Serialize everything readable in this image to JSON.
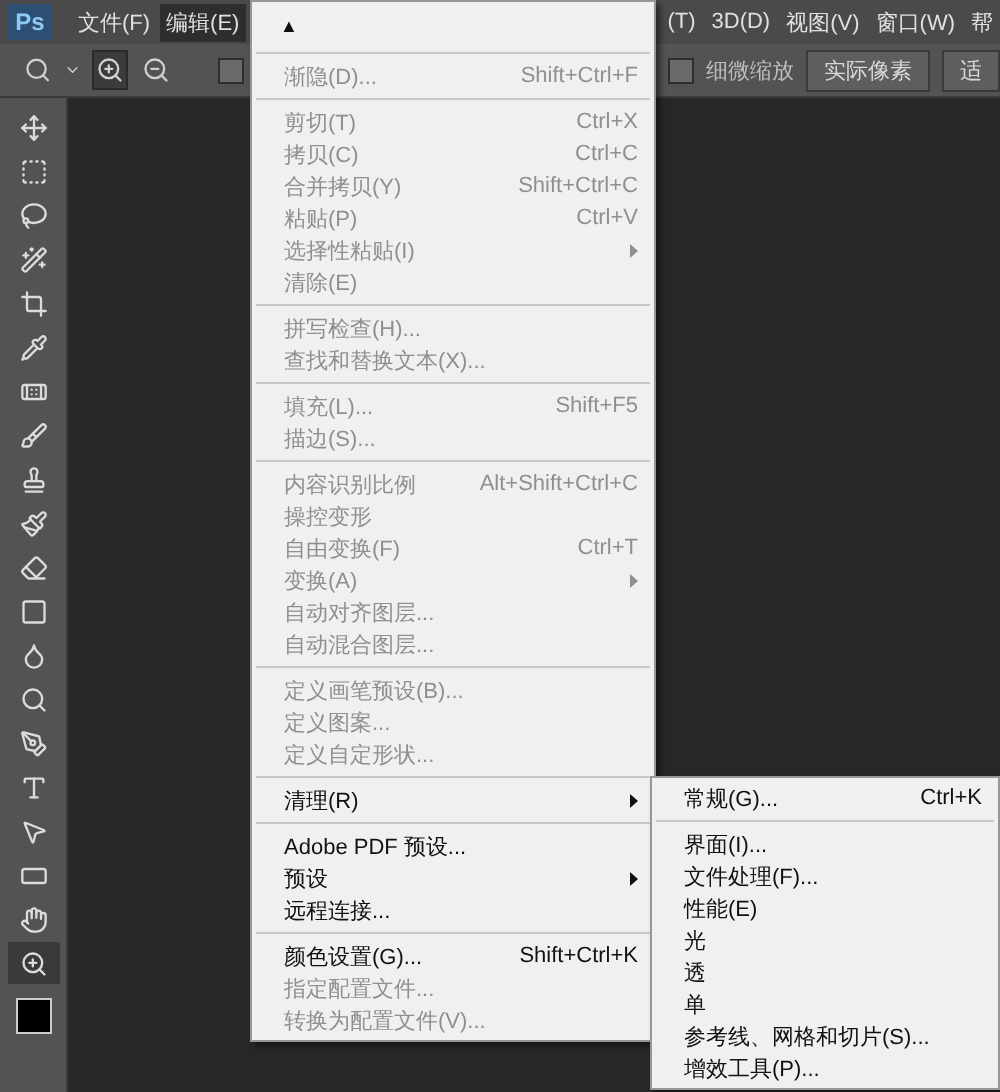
{
  "menubar": {
    "logo": "Ps",
    "items": [
      {
        "label": "文件(F)",
        "selected": false
      },
      {
        "label": "编辑(E)",
        "selected": true
      }
    ],
    "items_right": [
      {
        "label": "(T)"
      },
      {
        "label": "3D(D)"
      },
      {
        "label": "视图(V)"
      },
      {
        "label": "窗口(W)"
      },
      {
        "label": "帮"
      }
    ]
  },
  "options": {
    "zoom_modes": [
      {
        "kind": "in",
        "selected": true
      },
      {
        "kind": "out",
        "selected": false
      }
    ],
    "hidden_checkbox": {
      "checked": false
    },
    "fine_zoom": {
      "label": "细微缩放",
      "checked": false
    },
    "buttons": [
      "实际像素",
      "适"
    ]
  },
  "tools": [
    {
      "kind": "move",
      "selected": false
    },
    {
      "kind": "marquee",
      "selected": false
    },
    {
      "kind": "lasso",
      "selected": false
    },
    {
      "kind": "wand",
      "selected": false
    },
    {
      "kind": "crop",
      "selected": false
    },
    {
      "kind": "eyedropper",
      "selected": false
    },
    {
      "kind": "bandage",
      "selected": false
    },
    {
      "kind": "brush",
      "selected": false
    },
    {
      "kind": "stamp",
      "selected": false
    },
    {
      "kind": "history",
      "selected": false
    },
    {
      "kind": "eraser",
      "selected": false
    },
    {
      "kind": "gradient",
      "selected": false
    },
    {
      "kind": "drop",
      "selected": false
    },
    {
      "kind": "dodge",
      "selected": false
    },
    {
      "kind": "pen",
      "selected": false
    },
    {
      "kind": "type",
      "selected": false
    },
    {
      "kind": "pointer",
      "selected": false
    },
    {
      "kind": "rectangle",
      "selected": false
    },
    {
      "kind": "hand",
      "selected": false
    },
    {
      "kind": "zoom",
      "selected": true
    }
  ],
  "edit_menu": {
    "scroll_up": "▲",
    "groups": [
      [
        {
          "label": "渐隐(D)...",
          "shortcut": "Shift+Ctrl+F",
          "disabled": true,
          "submenu": false
        }
      ],
      [
        {
          "label": "剪切(T)",
          "shortcut": "Ctrl+X",
          "disabled": true,
          "submenu": false
        },
        {
          "label": "拷贝(C)",
          "shortcut": "Ctrl+C",
          "disabled": true,
          "submenu": false
        },
        {
          "label": "合并拷贝(Y)",
          "shortcut": "Shift+Ctrl+C",
          "disabled": true,
          "submenu": false
        },
        {
          "label": "粘贴(P)",
          "shortcut": "Ctrl+V",
          "disabled": true,
          "submenu": false
        },
        {
          "label": "选择性粘贴(I)",
          "disabled": true,
          "submenu": true
        },
        {
          "label": "清除(E)",
          "disabled": true,
          "submenu": false
        }
      ],
      [
        {
          "label": "拼写检查(H)...",
          "disabled": true,
          "submenu": false
        },
        {
          "label": "查找和替换文本(X)...",
          "disabled": true,
          "submenu": false
        }
      ],
      [
        {
          "label": "填充(L)...",
          "shortcut": "Shift+F5",
          "disabled": true,
          "submenu": false
        },
        {
          "label": "描边(S)...",
          "disabled": true,
          "submenu": false
        }
      ],
      [
        {
          "label": "内容识别比例",
          "shortcut": "Alt+Shift+Ctrl+C",
          "disabled": true,
          "submenu": false
        },
        {
          "label": "操控变形",
          "disabled": true,
          "submenu": false
        },
        {
          "label": "自由变换(F)",
          "shortcut": "Ctrl+T",
          "disabled": true,
          "submenu": false
        },
        {
          "label": "变换(A)",
          "disabled": true,
          "submenu": true
        },
        {
          "label": "自动对齐图层...",
          "disabled": true,
          "submenu": false
        },
        {
          "label": "自动混合图层...",
          "disabled": true,
          "submenu": false
        }
      ],
      [
        {
          "label": "定义画笔预设(B)...",
          "disabled": true,
          "submenu": false
        },
        {
          "label": "定义图案...",
          "disabled": true,
          "submenu": false
        },
        {
          "label": "定义自定形状...",
          "disabled": true,
          "submenu": false
        }
      ],
      [
        {
          "label": "清理(R)",
          "disabled": false,
          "submenu": true
        }
      ],
      [
        {
          "label": "Adobe PDF 预设...",
          "disabled": false,
          "submenu": false
        },
        {
          "label": "预设",
          "disabled": false,
          "submenu": true
        },
        {
          "label": "远程连接...",
          "disabled": false,
          "submenu": false
        }
      ],
      [
        {
          "label": "颜色设置(G)...",
          "shortcut": "Shift+Ctrl+K",
          "disabled": false,
          "submenu": false
        },
        {
          "label": "指定配置文件...",
          "disabled": true,
          "submenu": false
        },
        {
          "label": "转换为配置文件(V)...",
          "disabled": true,
          "submenu": false
        }
      ]
    ]
  },
  "preferences_menu": {
    "groups": [
      [
        {
          "label": "常规(G)...",
          "shortcut": "Ctrl+K"
        }
      ],
      [
        {
          "label": "界面(I)..."
        },
        {
          "label": "文件处理(F)..."
        },
        {
          "label": "性能(E)"
        },
        {
          "label": "光"
        },
        {
          "label": "透"
        },
        {
          "label": "单"
        },
        {
          "label": "参考线、网格和切片(S)..."
        },
        {
          "label": "增效工具(P)..."
        }
      ]
    ]
  }
}
